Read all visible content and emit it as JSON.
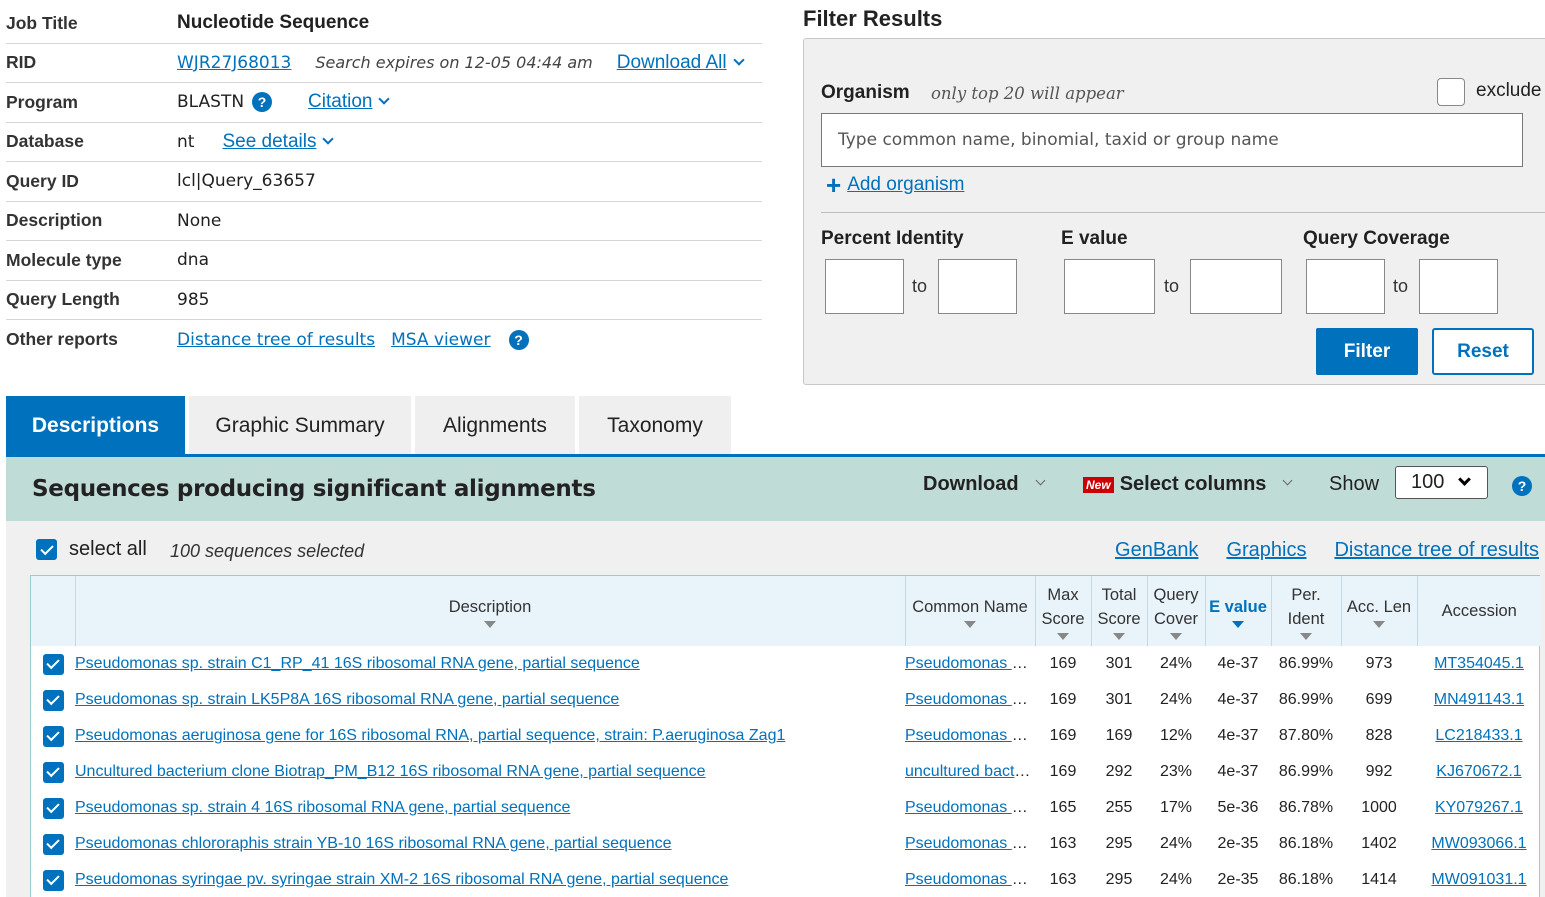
{
  "summary": {
    "job_title": {
      "label": "Job Title",
      "value": "Nucleotide Sequence"
    },
    "rid": {
      "label": "RID",
      "value": "WJR27J68013",
      "expires": "Search expires on 12-05 04:44 am",
      "download_all": "Download All"
    },
    "program": {
      "label": "Program",
      "value": "BLASTN",
      "citation": "Citation"
    },
    "database": {
      "label": "Database",
      "value": "nt",
      "see_details": "See details"
    },
    "query_id": {
      "label": "Query ID",
      "value": "lcl|Query_63657"
    },
    "description": {
      "label": "Description",
      "value": "None"
    },
    "molecule_type": {
      "label": "Molecule type",
      "value": "dna"
    },
    "query_length": {
      "label": "Query Length",
      "value": "985"
    },
    "other_reports": {
      "label": "Other reports",
      "distance_tree": "Distance tree of results",
      "msa_viewer": "MSA viewer"
    }
  },
  "filter": {
    "title": "Filter Results",
    "organism_label": "Organism",
    "organism_hint": "only top 20 will appear",
    "exclude_label": "exclude",
    "organism_placeholder": "Type common  name, binomial, taxid or group  name",
    "add_organism": "Add organism",
    "percent_identity": "Percent Identity",
    "e_value": "E value",
    "query_coverage": "Query Coverage",
    "to": "to",
    "filter_button": "Filter",
    "reset_button": "Reset"
  },
  "tabs": [
    "Descriptions",
    "Graphic Summary",
    "Alignments",
    "Taxonomy"
  ],
  "results": {
    "title": "Sequences producing significant alignments",
    "download": "Download",
    "new_badge": "New",
    "select_columns": "Select columns",
    "show_label": "Show",
    "show_value": "100",
    "select_all": "select all",
    "selected_count": "100 sequences selected",
    "links": [
      "GenBank",
      "Graphics",
      "Distance tree of results"
    ],
    "columns": {
      "description": "Description",
      "common_name": "Common Name",
      "max_score": "Max Score",
      "total_score": "Total Score",
      "query_cover": "Query Cover",
      "e_value": "E value",
      "per_ident": "Per. Ident",
      "acc_len": "Acc. Len",
      "accession": "Accession"
    },
    "rows": [
      {
        "description": "Pseudomonas sp. strain C1_RP_41 16S ribosomal RNA gene, partial sequence",
        "common_name": "Pseudomonas sp.",
        "max_score": "169",
        "total_score": "301",
        "query_cover": "24%",
        "e_value": "4e-37",
        "per_ident": "86.99%",
        "acc_len": "973",
        "accession": "MT354045.1"
      },
      {
        "description": "Pseudomonas sp. strain LK5P8A 16S ribosomal RNA gene, partial sequence",
        "common_name": "Pseudomonas sp.",
        "max_score": "169",
        "total_score": "301",
        "query_cover": "24%",
        "e_value": "4e-37",
        "per_ident": "86.99%",
        "acc_len": "699",
        "accession": "MN491143.1"
      },
      {
        "description": "Pseudomonas aeruginosa gene for 16S ribosomal RNA, partial sequence, strain: P.aeruginosa Zag1",
        "common_name": "Pseudomonas aeruginosa",
        "max_score": "169",
        "total_score": "169",
        "query_cover": "12%",
        "e_value": "4e-37",
        "per_ident": "87.80%",
        "acc_len": "828",
        "accession": "LC218433.1"
      },
      {
        "description": "Uncultured bacterium clone Biotrap_PM_B12 16S ribosomal RNA gene, partial sequence",
        "common_name": "uncultured bacterium",
        "max_score": "169",
        "total_score": "292",
        "query_cover": "23%",
        "e_value": "4e-37",
        "per_ident": "86.99%",
        "acc_len": "992",
        "accession": "KJ670672.1"
      },
      {
        "description": "Pseudomonas sp. strain 4 16S ribosomal RNA gene, partial sequence",
        "common_name": "Pseudomonas sp.",
        "max_score": "165",
        "total_score": "255",
        "query_cover": "17%",
        "e_value": "5e-36",
        "per_ident": "86.78%",
        "acc_len": "1000",
        "accession": "KY079267.1"
      },
      {
        "description": "Pseudomonas chlororaphis strain YB-10 16S ribosomal RNA gene, partial sequence",
        "common_name": "Pseudomonas chlororaphis",
        "max_score": "163",
        "total_score": "295",
        "query_cover": "24%",
        "e_value": "2e-35",
        "per_ident": "86.18%",
        "acc_len": "1402",
        "accession": "MW093066.1"
      },
      {
        "description": "Pseudomonas syringae pv. syringae strain XM-2 16S ribosomal RNA gene, partial sequence",
        "common_name": "Pseudomonas syringae",
        "max_score": "163",
        "total_score": "295",
        "query_cover": "24%",
        "e_value": "2e-35",
        "per_ident": "86.18%",
        "acc_len": "1414",
        "accession": "MW091031.1"
      }
    ]
  }
}
